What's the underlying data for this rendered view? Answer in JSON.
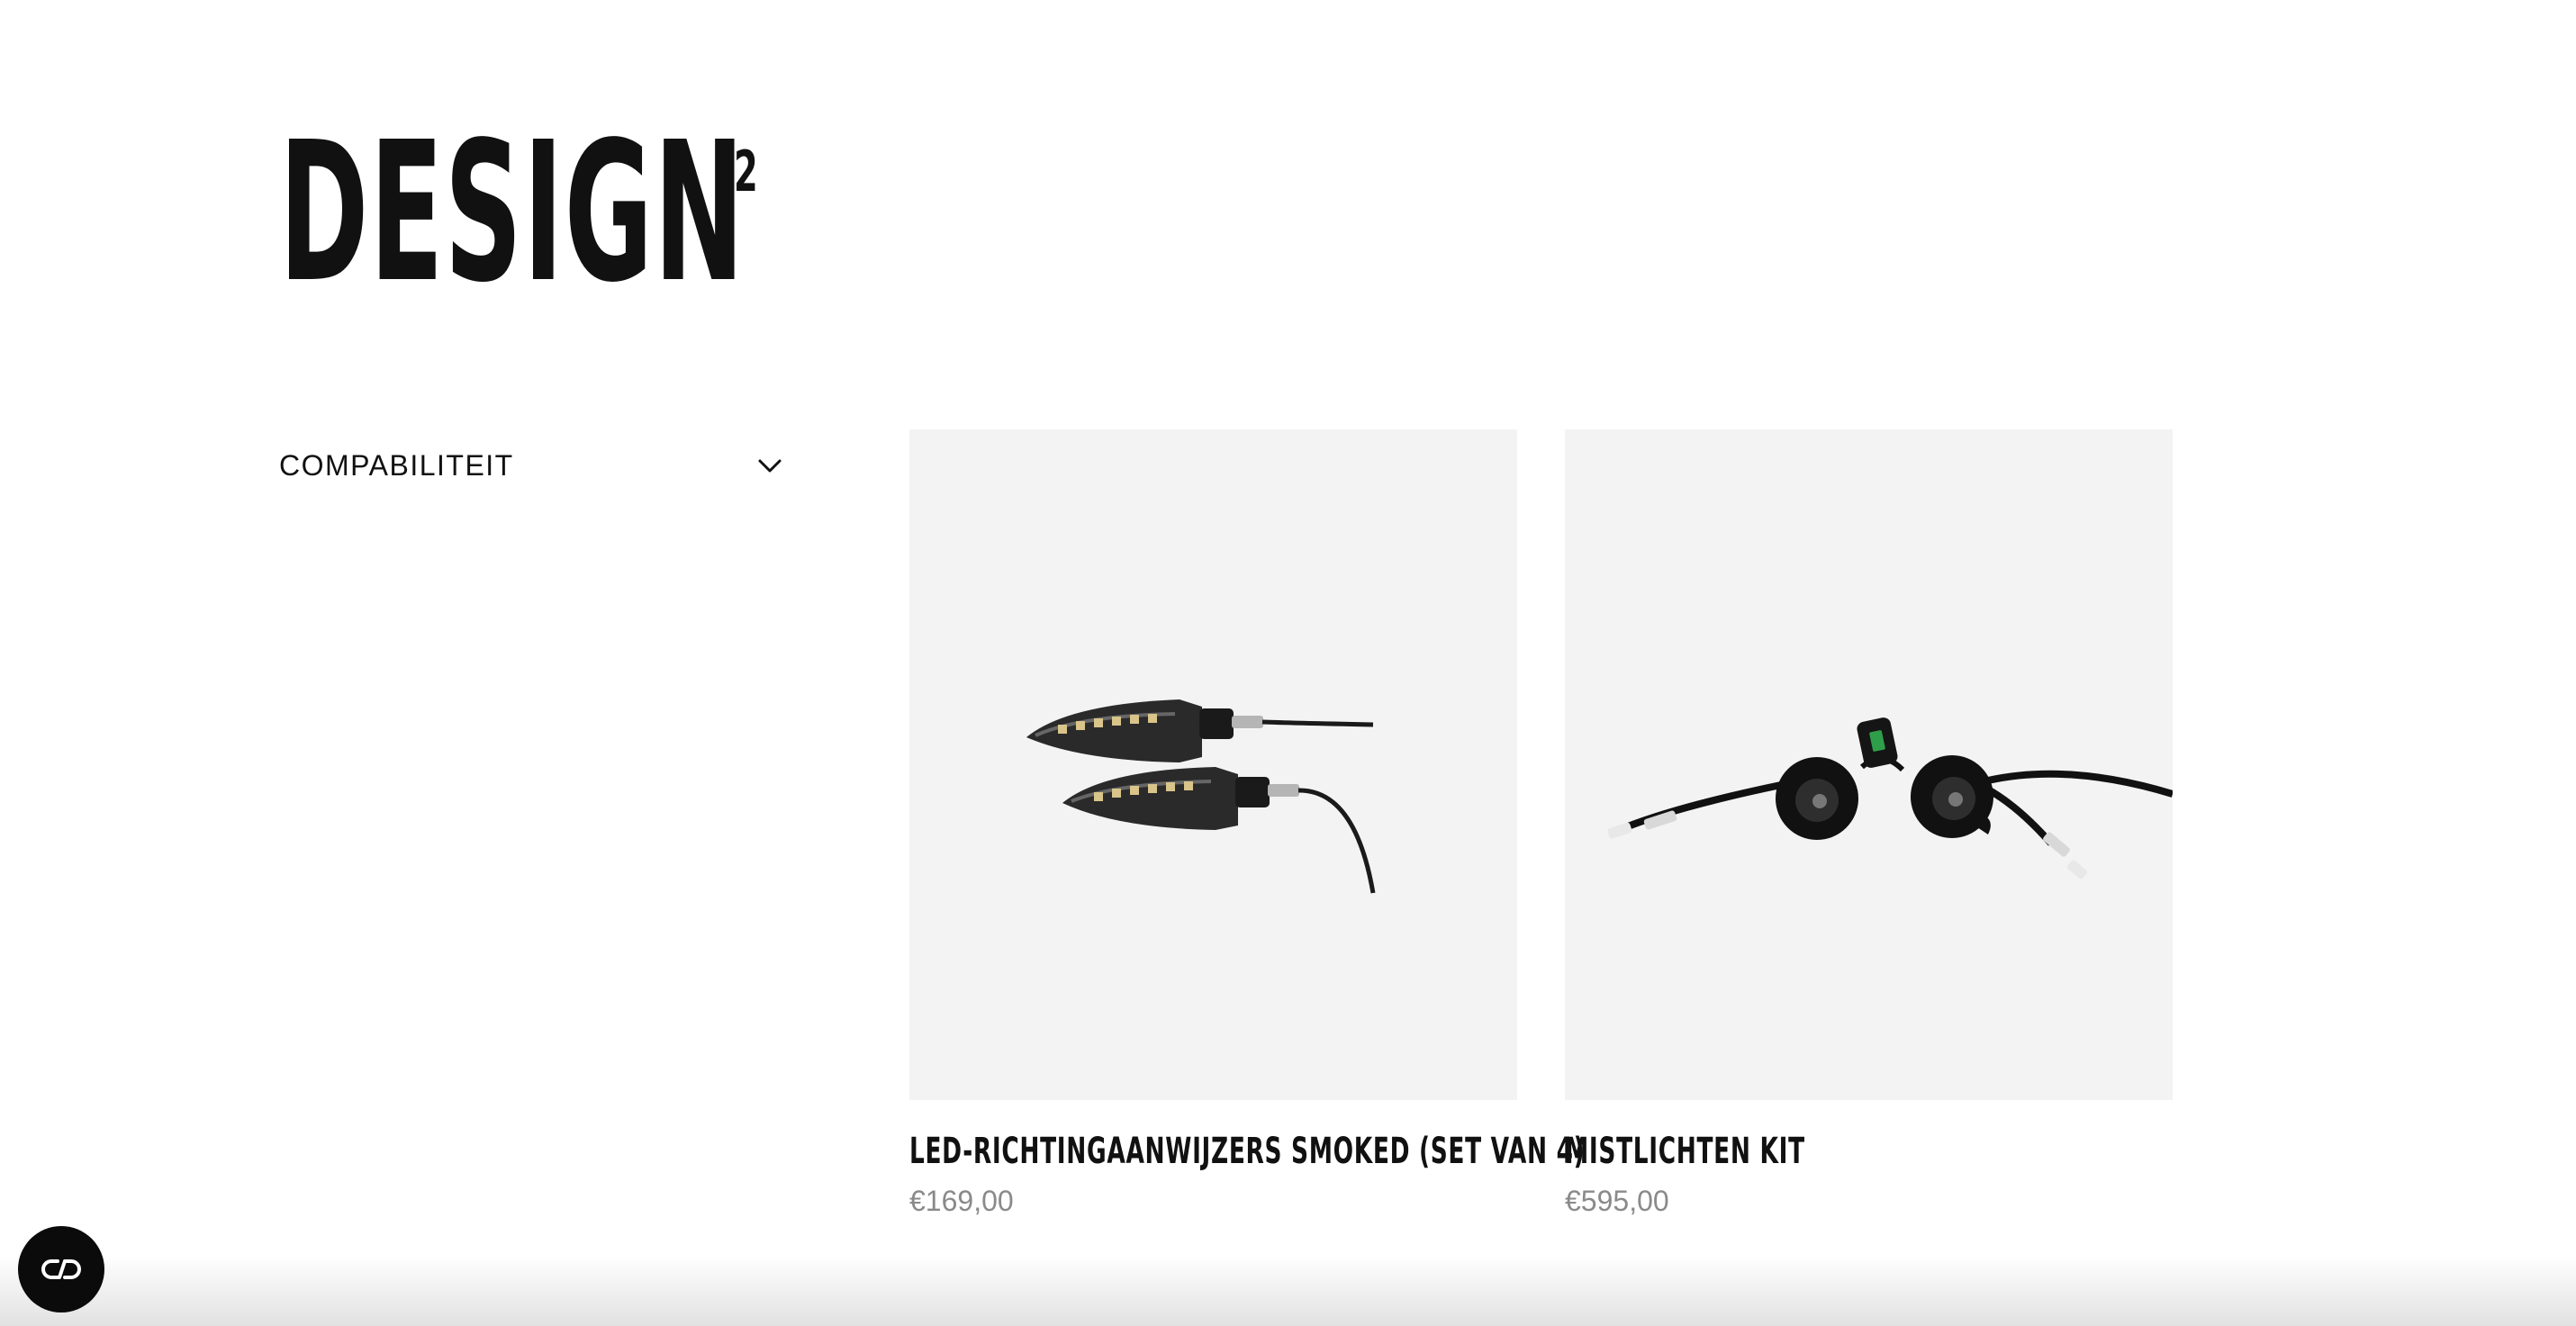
{
  "page": {
    "title": "DESIGN",
    "count": "2"
  },
  "filters": {
    "compatibility": {
      "label": "COMPABILITEIT",
      "icon": "chevron-down-icon"
    }
  },
  "products": [
    {
      "name": "LED-RICHTINGAANWIJZERS SMOKED (SET VAN 4)",
      "price": "€169,00"
    },
    {
      "name": "MISTLICHTEN KIT",
      "price": "€595,00"
    }
  ],
  "chat": {
    "icon": "chat-link-icon"
  },
  "colors": {
    "text": "#111111",
    "price": "#8a8a8a",
    "image_bg": "#f3f3f3",
    "chat_bg": "#0b0b0b"
  }
}
